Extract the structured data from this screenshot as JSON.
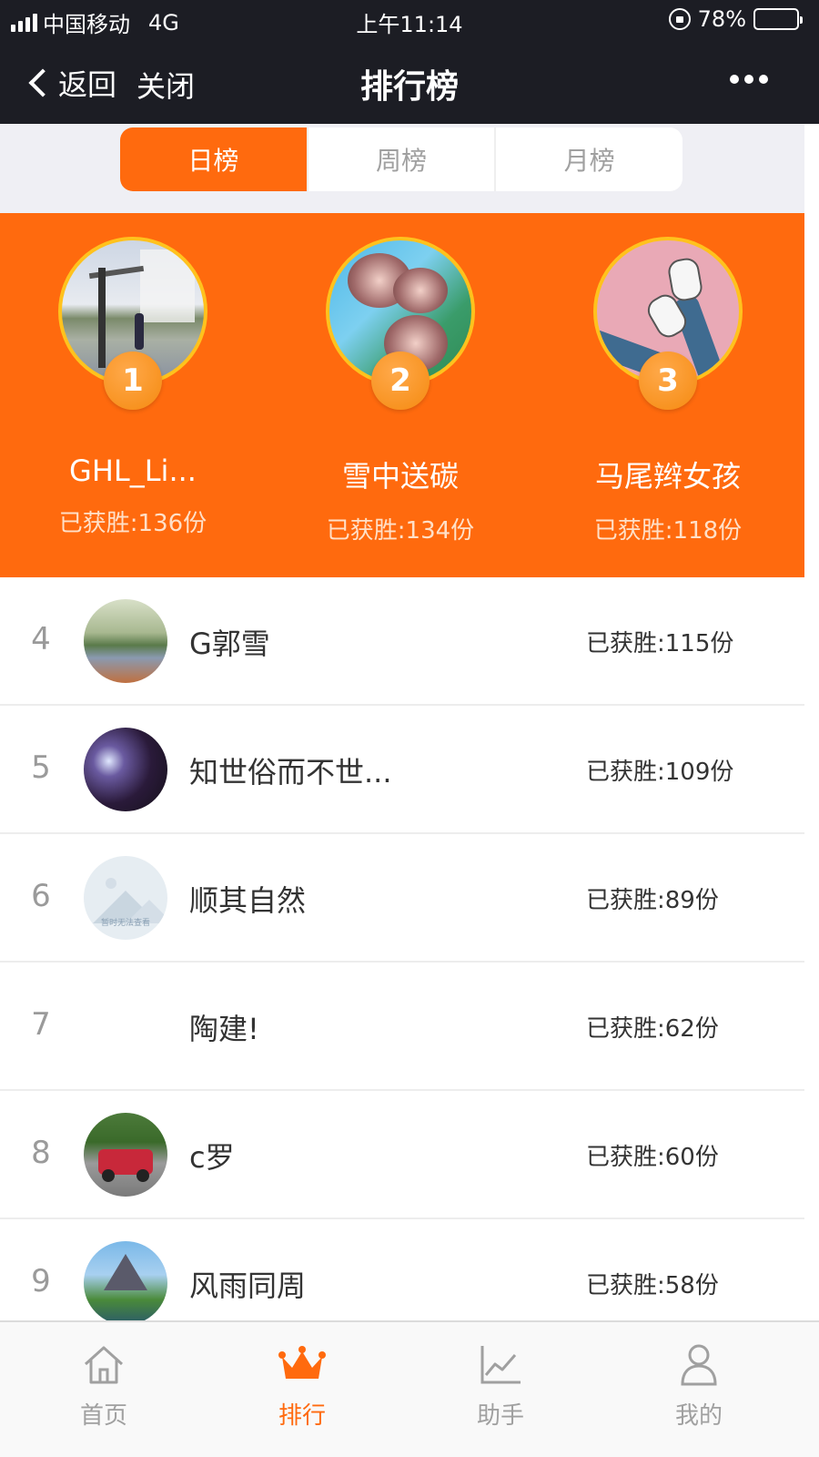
{
  "status_bar": {
    "carrier": "中国移动",
    "network": "4G",
    "time": "上午11:14",
    "battery": "78%",
    "battery_level": 0.78
  },
  "nav": {
    "back_label": "返回",
    "close_label": "关闭",
    "title": "排行榜"
  },
  "tabs": [
    {
      "label": "日榜",
      "active": true
    },
    {
      "label": "周榜",
      "active": false
    },
    {
      "label": "月榜",
      "active": false
    }
  ],
  "podium": [
    {
      "rank": "1",
      "name": "GHL_Li...",
      "score": "已获胜:136份"
    },
    {
      "rank": "2",
      "name": "雪中送碳",
      "score": "已获胜:134份"
    },
    {
      "rank": "3",
      "name": "马尾辫女孩",
      "score": "已获胜:118份"
    }
  ],
  "list": [
    {
      "rank": "4",
      "name": "G郭雪",
      "score": "已获胜:115份"
    },
    {
      "rank": "5",
      "name": "知世俗而不世...",
      "score": "已获胜:109份"
    },
    {
      "rank": "6",
      "name": "顺其自然",
      "score": "已获胜:89份",
      "avatar_text": "暂时无法查看"
    },
    {
      "rank": "7",
      "name": "陶建!",
      "score": "已获胜:62份"
    },
    {
      "rank": "8",
      "name": "c罗",
      "score": "已获胜:60份"
    },
    {
      "rank": "9",
      "name": "风雨同周",
      "score": "已获胜:58份"
    }
  ],
  "bottom_tabs": [
    {
      "label": "首页",
      "icon": "home-icon",
      "active": false
    },
    {
      "label": "排行",
      "icon": "crown-icon",
      "active": true
    },
    {
      "label": "助手",
      "icon": "chart-icon",
      "active": false
    },
    {
      "label": "我的",
      "icon": "person-icon",
      "active": false
    }
  ],
  "colors": {
    "accent": "#ff6a0e",
    "nav_bg": "#1c1d24",
    "gold_ring": "#ffc21d",
    "inactive": "#a0a0a0"
  }
}
